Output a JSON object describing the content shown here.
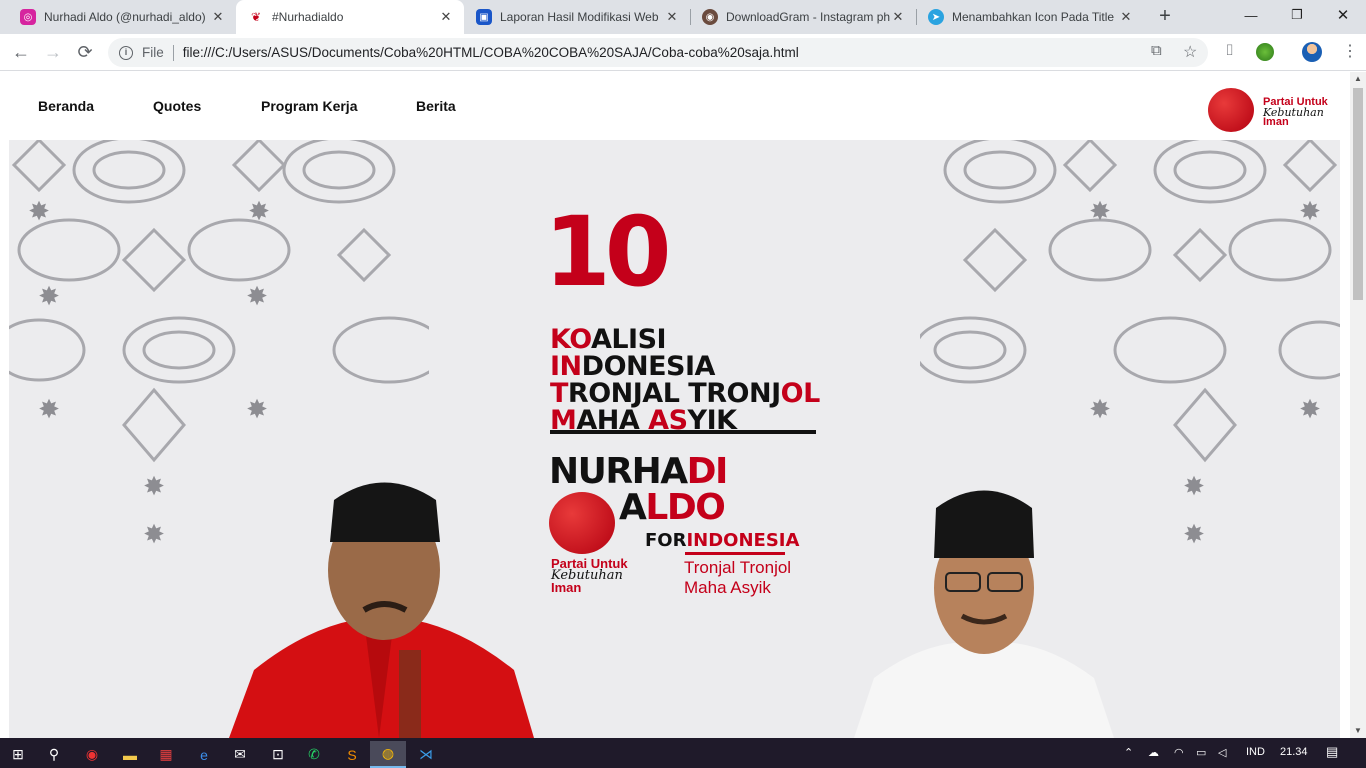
{
  "browser": {
    "tabs": [
      {
        "title": "Nurhadi Aldo (@nurhadi_aldo)",
        "favicon": "instagram-icon",
        "color": "#d6249f",
        "active": false
      },
      {
        "title": "#Nurhadialdo",
        "favicon": "party-logo-icon",
        "color": "#c4001a",
        "active": true
      },
      {
        "title": "Laporan Hasil Modifikasi Web",
        "favicon": "slides-icon",
        "color": "#1a56c8",
        "active": false
      },
      {
        "title": "DownloadGram - Instagram ph",
        "favicon": "downloadgram-icon",
        "color": "#6b4b3e",
        "active": false
      },
      {
        "title": "Menambahkan Icon Pada Title",
        "favicon": "telegram-icon",
        "color": "#2aa3e0",
        "active": false
      }
    ],
    "close_glyph": "✕",
    "new_tab_glyph": "+",
    "window": {
      "minimize": "—",
      "maximize": "❐",
      "close": "✕"
    },
    "toolbar": {
      "back": "←",
      "forward": "→",
      "reload": "⟳",
      "menu": "⋮"
    },
    "omnibox": {
      "info_glyph": "i",
      "scheme": "File",
      "url": "file:///C:/Users/ASUS/Documents/Coba%20HTML/COBA%20COBA%20SAJA/Coba-coba%20saja.html"
    }
  },
  "page": {
    "nav": [
      {
        "label": "Beranda"
      },
      {
        "label": "Quotes"
      },
      {
        "label": "Program Kerja"
      },
      {
        "label": "Berita"
      }
    ],
    "brand": {
      "line1": "Partai Untuk",
      "line2": "Kebutuhan",
      "line3": "Iman"
    },
    "hero": {
      "number": "10",
      "koalisi": [
        {
          "red": "KO",
          "rest": "ALISI"
        },
        {
          "red": "IN",
          "rest": "DONESIA"
        },
        {
          "red": "T",
          "rest": "RONJAL TRONJ",
          "red2": "OL",
          "rest2": ""
        },
        {
          "red": "M",
          "rest": "AHA ",
          "red2": "AS",
          "rest2": "YIK"
        }
      ],
      "name_first_black": "NURHA",
      "name_first_red": "DI",
      "name_second_black": "A",
      "name_second_red": "LDO",
      "for_black": "FOR",
      "for_red": "INDONESIA",
      "tagline_1": "Tronjal Tronjol",
      "tagline_2": "Maha Asyik",
      "badge": {
        "line1": "Partai Untuk",
        "line2": "Kebutuhan",
        "line3": "Iman"
      }
    }
  },
  "taskbar": {
    "language": "IND",
    "time": "21.34"
  },
  "colors": {
    "accent_red": "#c4001a",
    "hero_bg": "#ececee"
  }
}
